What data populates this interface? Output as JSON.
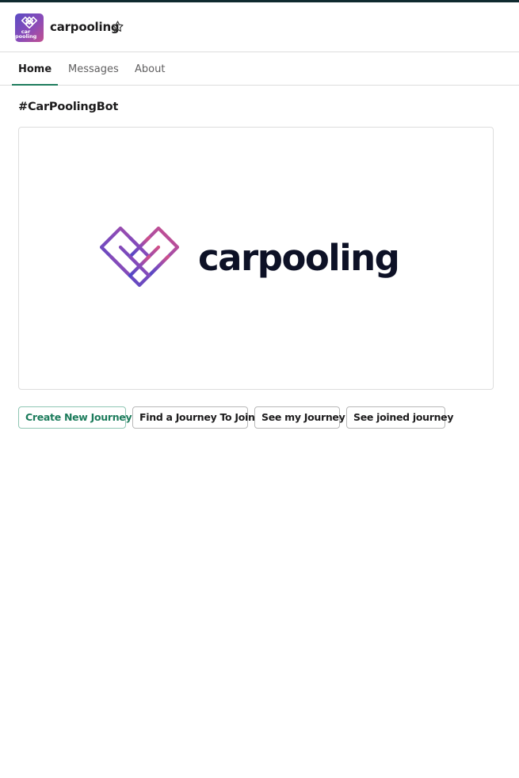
{
  "app": {
    "name": "carpooling",
    "icon_text_line1": "car",
    "icon_text_line2": "pooling",
    "icon": "carpooling-logo-icon",
    "star_icon": "star-outline-icon"
  },
  "tabs": [
    {
      "label": "Home",
      "active": true
    },
    {
      "label": "Messages",
      "active": false
    },
    {
      "label": "About",
      "active": false
    }
  ],
  "main": {
    "channel_title": "#CarPoolingBot",
    "banner": {
      "logo_icon": "carpooling-heart-logo-icon",
      "wordmark": "carpooling"
    },
    "buttons": [
      {
        "label": "Create New Journey",
        "style": "primary"
      },
      {
        "label": "Find a Journey To Join",
        "style": "default"
      },
      {
        "label": "See my Journey",
        "style": "default"
      },
      {
        "label": "See joined journey",
        "style": "default"
      }
    ]
  },
  "colors": {
    "accent_green": "#1d7c5c",
    "logo_gradient_start": "#5b4cc4",
    "logo_gradient_end": "#d15088",
    "wordmark": "#0d1126"
  }
}
